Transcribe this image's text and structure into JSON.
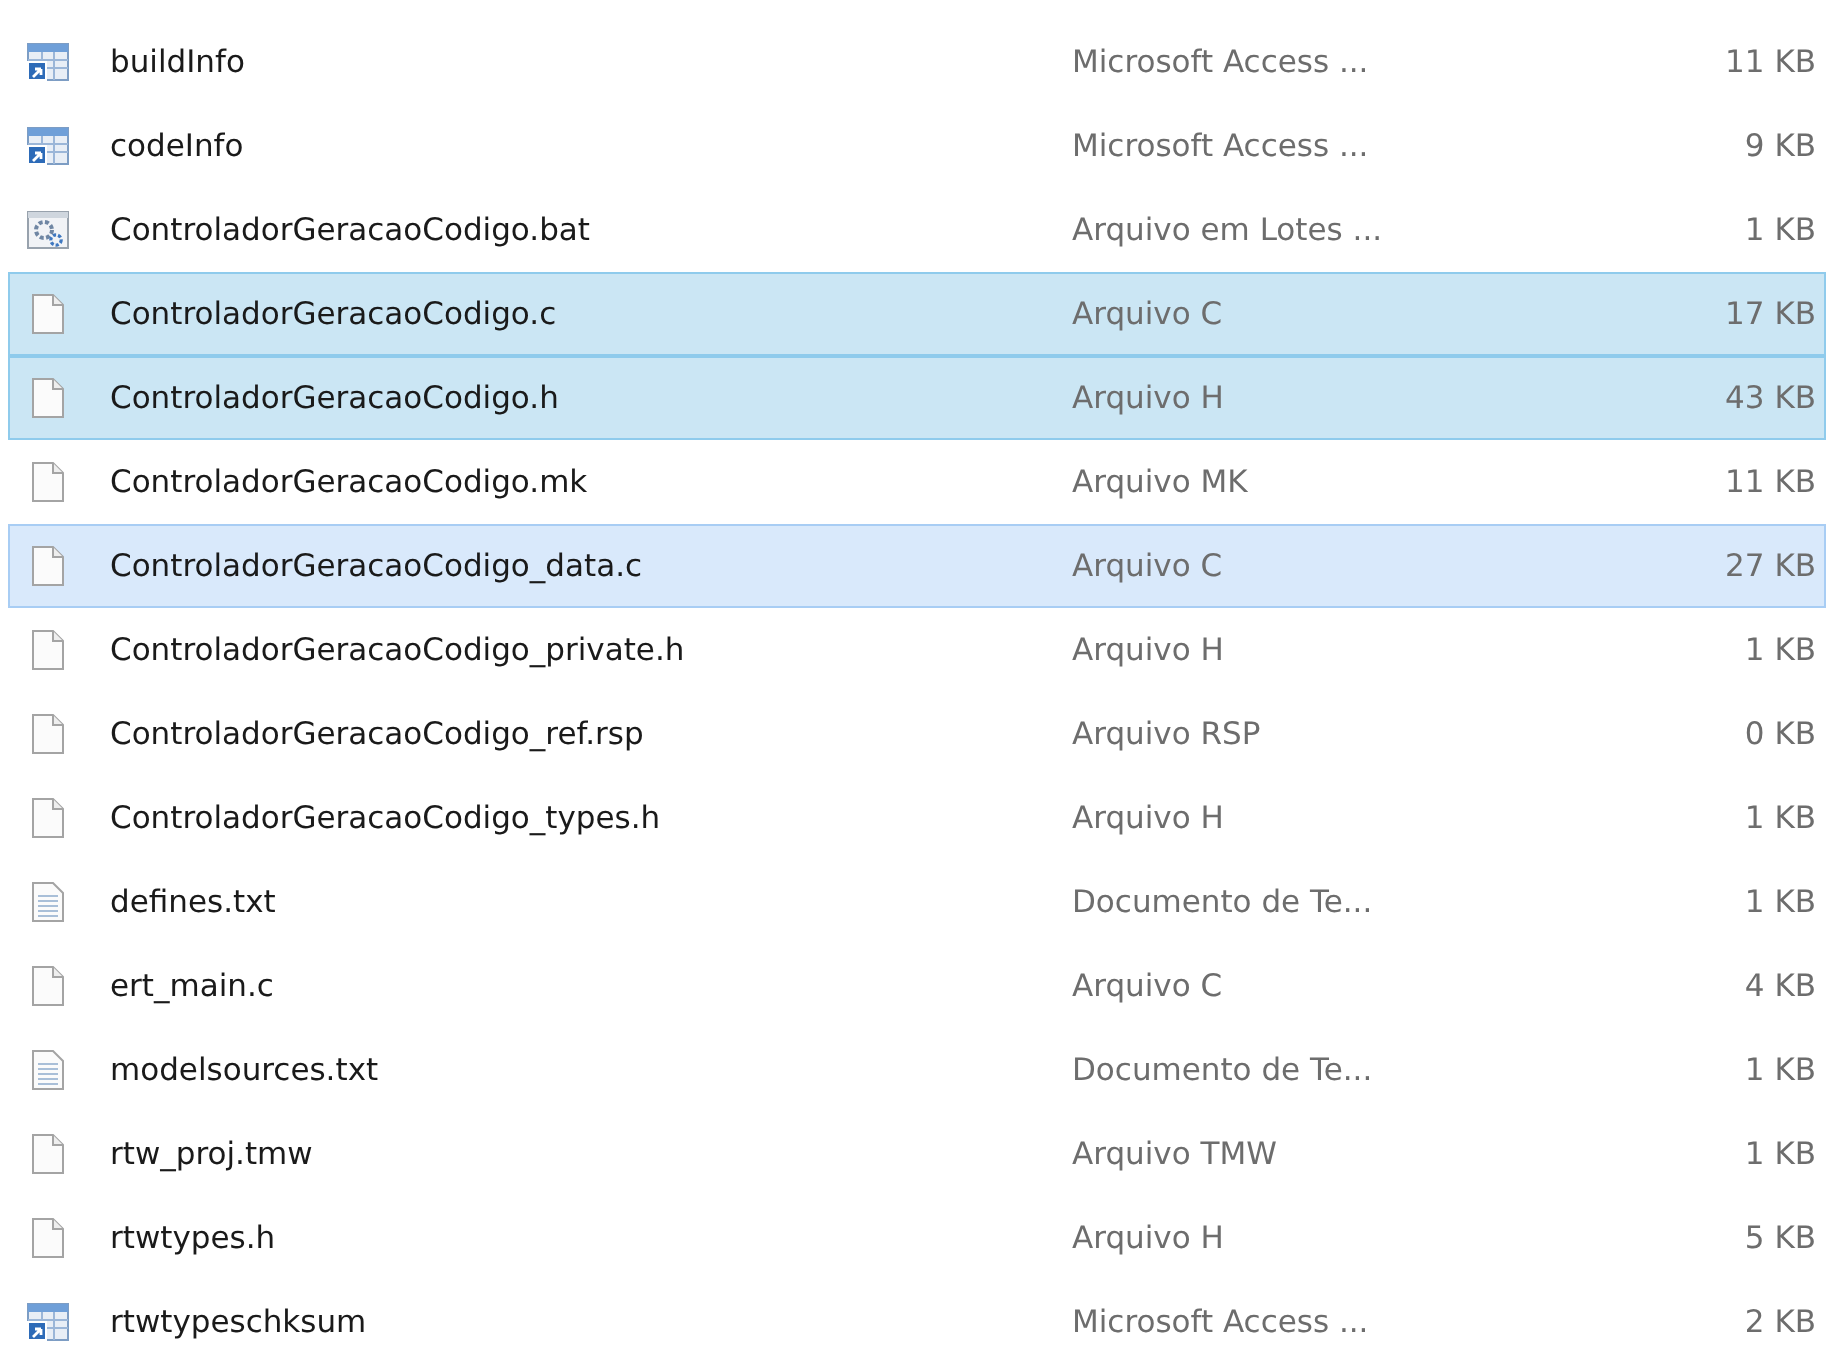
{
  "files": [
    {
      "kind": "table",
      "name": "buildInfo",
      "type": "Microsoft Access ...",
      "size": "11 KB",
      "selected": false,
      "hovered": false
    },
    {
      "kind": "table",
      "name": "codeInfo",
      "type": "Microsoft Access ...",
      "size": "9 KB",
      "selected": false,
      "hovered": false
    },
    {
      "kind": "batch",
      "name": "ControladorGeracaoCodigo.bat",
      "type": "Arquivo em Lotes ...",
      "size": "1 KB",
      "selected": false,
      "hovered": false
    },
    {
      "kind": "blank",
      "name": "ControladorGeracaoCodigo.c",
      "type": "Arquivo C",
      "size": "17 KB",
      "selected": true,
      "hovered": false
    },
    {
      "kind": "blank",
      "name": "ControladorGeracaoCodigo.h",
      "type": "Arquivo H",
      "size": "43 KB",
      "selected": true,
      "hovered": false
    },
    {
      "kind": "blank",
      "name": "ControladorGeracaoCodigo.mk",
      "type": "Arquivo MK",
      "size": "11 KB",
      "selected": false,
      "hovered": false
    },
    {
      "kind": "blank",
      "name": "ControladorGeracaoCodigo_data.c",
      "type": "Arquivo C",
      "size": "27 KB",
      "selected": false,
      "hovered": true
    },
    {
      "kind": "blank",
      "name": "ControladorGeracaoCodigo_private.h",
      "type": "Arquivo H",
      "size": "1 KB",
      "selected": false,
      "hovered": false
    },
    {
      "kind": "blank",
      "name": "ControladorGeracaoCodigo_ref.rsp",
      "type": "Arquivo RSP",
      "size": "0 KB",
      "selected": false,
      "hovered": false
    },
    {
      "kind": "blank",
      "name": "ControladorGeracaoCodigo_types.h",
      "type": "Arquivo H",
      "size": "1 KB",
      "selected": false,
      "hovered": false
    },
    {
      "kind": "text",
      "name": "defines.txt",
      "type": "Documento de Te...",
      "size": "1 KB",
      "selected": false,
      "hovered": false
    },
    {
      "kind": "blank",
      "name": "ert_main.c",
      "type": "Arquivo C",
      "size": "4 KB",
      "selected": false,
      "hovered": false
    },
    {
      "kind": "text",
      "name": "modelsources.txt",
      "type": "Documento de Te...",
      "size": "1 KB",
      "selected": false,
      "hovered": false
    },
    {
      "kind": "blank",
      "name": "rtw_proj.tmw",
      "type": "Arquivo TMW",
      "size": "1 KB",
      "selected": false,
      "hovered": false
    },
    {
      "kind": "blank",
      "name": "rtwtypes.h",
      "type": "Arquivo H",
      "size": "5 KB",
      "selected": false,
      "hovered": false
    },
    {
      "kind": "table",
      "name": "rtwtypeschksum",
      "type": "Microsoft Access ...",
      "size": "2 KB",
      "selected": false,
      "hovered": false
    }
  ]
}
